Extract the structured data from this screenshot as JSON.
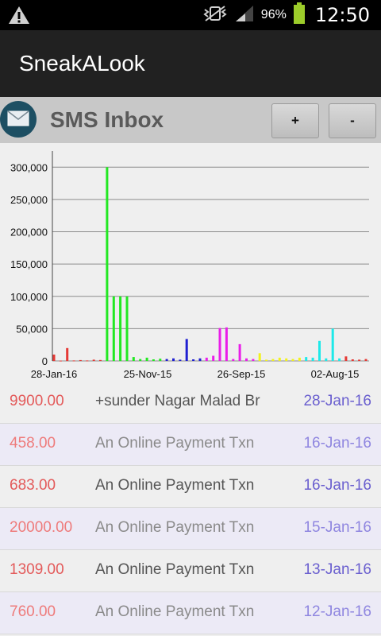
{
  "status_bar": {
    "battery_percent": "96%",
    "time": "12:50",
    "icons": [
      "warning-icon",
      "vibrate-icon",
      "signal-icon",
      "battery-icon"
    ]
  },
  "app": {
    "title": "SneakALook"
  },
  "inbox": {
    "title": "SMS Inbox",
    "plus_label": "+",
    "minus_label": "-"
  },
  "chart_data": {
    "type": "bar",
    "ylim": [
      0,
      320000
    ],
    "y_ticks": [
      "0",
      "50,000",
      "100,000",
      "150,000",
      "200,000",
      "250,000",
      "300,000"
    ],
    "x_tick_labels": [
      "28-Jan-16",
      "25-Nov-15",
      "26-Sep-15",
      "02-Aug-15"
    ],
    "grid": true,
    "series": [
      {
        "color": "#e53935",
        "values": [
          9900,
          458,
          20000,
          683,
          1309,
          760,
          2000,
          1500
        ]
      },
      {
        "color": "#22e822",
        "values": [
          300000,
          100000,
          100000,
          100000,
          6000,
          3000,
          5000,
          2500,
          3500
        ]
      },
      {
        "color": "#1f1fd1",
        "values": [
          3000,
          4000,
          2000,
          34000,
          2500,
          4000
        ]
      },
      {
        "color": "#e91ee9",
        "values": [
          5000,
          8000,
          51000,
          52000,
          3000,
          26000,
          4000,
          3000
        ]
      },
      {
        "color": "#f2f21c",
        "values": [
          12000,
          2000,
          3000,
          5000,
          4000,
          3000,
          5000
        ]
      },
      {
        "color": "#1de9e9",
        "values": [
          6000,
          5000,
          31000,
          4000,
          50000,
          4000
        ]
      },
      {
        "color": "#e53935",
        "values": [
          7000,
          2500,
          2000,
          3000
        ]
      }
    ]
  },
  "messages": [
    {
      "amount": "9900.00",
      "desc": "+sunder Nagar Malad Br",
      "date": "28-Jan-16"
    },
    {
      "amount": "458.00",
      "desc": "An Online Payment Txn",
      "date": "16-Jan-16"
    },
    {
      "amount": "683.00",
      "desc": "An Online Payment Txn",
      "date": "16-Jan-16"
    },
    {
      "amount": "20000.00",
      "desc": "An Online Payment Txn",
      "date": "15-Jan-16"
    },
    {
      "amount": "1309.00",
      "desc": "An Online Payment Txn",
      "date": "13-Jan-16"
    },
    {
      "amount": "760.00",
      "desc": "An Online Payment Txn",
      "date": "12-Jan-16"
    }
  ],
  "colors": {
    "amount_odd": "#e35a5a",
    "amount_even": "#ee7b7b",
    "desc_odd": "#555555",
    "desc_even": "#8a8a8a",
    "date_odd": "#6a5fcf",
    "date_even": "#8f86e0"
  }
}
